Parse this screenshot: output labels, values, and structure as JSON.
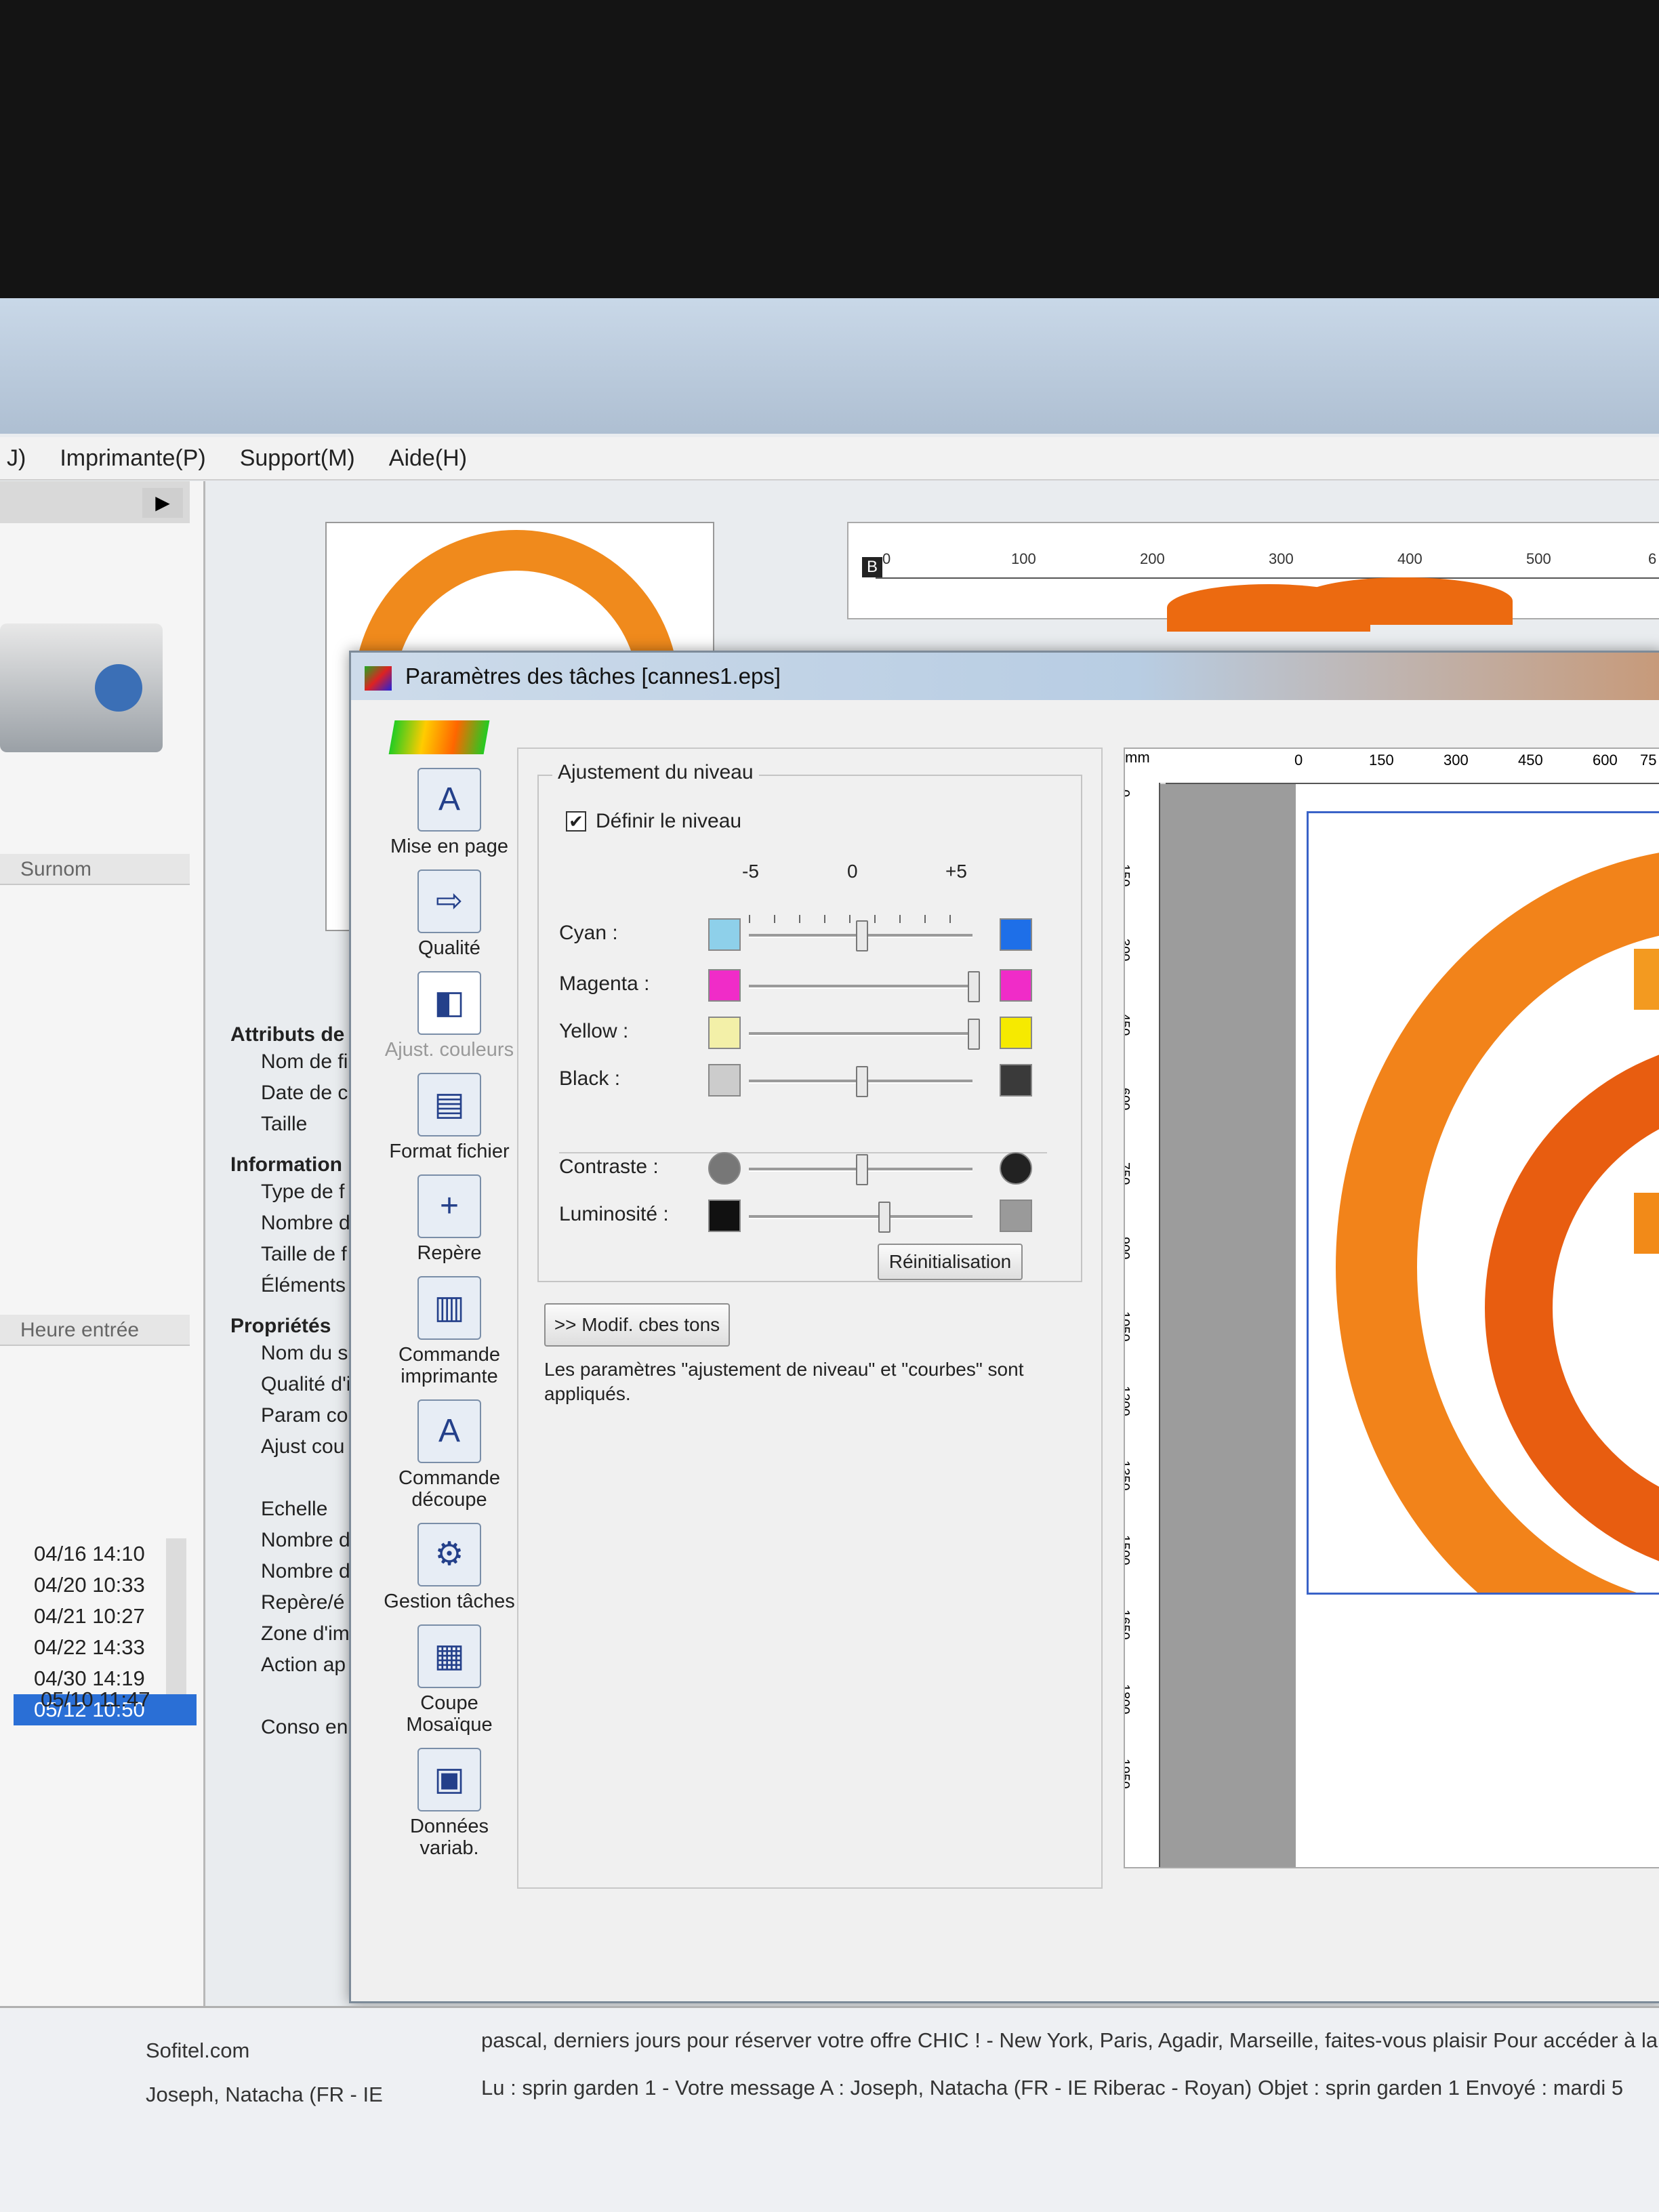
{
  "menubar": {
    "items": [
      "J)",
      "Imprimante(P)",
      "Support(M)",
      "Aide(H)"
    ]
  },
  "left_panel": {
    "col1": "Surnom",
    "col2": "Heure entrée",
    "dates": [
      "04/16 14:10",
      "04/20 10:33",
      "04/21 10:27",
      "04/22 14:33",
      "04/30 14:19",
      "05/12 10:50"
    ],
    "selected_index": 5,
    "extra_date": "05/10 11:47"
  },
  "properties": {
    "sections": [
      {
        "title": "Attributs de",
        "items": [
          "Nom de fi",
          "Date de c",
          "Taille"
        ]
      },
      {
        "title": "Information",
        "items": [
          "Type de f",
          "Nombre d",
          "Taille de f",
          "Éléments"
        ]
      },
      {
        "title": "Propriétés",
        "items": [
          "Nom du s",
          "Qualité d'i",
          "Param co",
          "Ajust cou",
          "",
          "Echelle",
          "Nombre d",
          "Nombre d",
          "Repère/é",
          "Zone d'im",
          "Action ap",
          "",
          "Conso en"
        ]
      }
    ]
  },
  "ruler_top": {
    "marker": "B",
    "ticks": [
      "0",
      "100",
      "200",
      "300",
      "400",
      "500",
      "6"
    ]
  },
  "dialog": {
    "title": "Paramètres des tâches [cannes1.eps]",
    "nav": [
      {
        "label": "Mise en page",
        "icon": "page-layout-icon",
        "glyph": "A"
      },
      {
        "label": "Qualité",
        "icon": "quality-icon",
        "glyph": "⇨"
      },
      {
        "label": "Ajust. couleurs",
        "icon": "color-adjust-icon",
        "glyph": "◧",
        "active": true
      },
      {
        "label": "Format fichier",
        "icon": "file-format-icon",
        "glyph": "▤"
      },
      {
        "label": "Repère",
        "icon": "marker-icon",
        "glyph": "+"
      },
      {
        "label": "Commande imprimante",
        "icon": "printer-command-icon",
        "glyph": "▥"
      },
      {
        "label": "Commande découpe",
        "icon": "cut-command-icon",
        "glyph": "A"
      },
      {
        "label": "Gestion tâches",
        "icon": "task-management-icon",
        "glyph": "⚙"
      },
      {
        "label": "Coupe Mosaïque",
        "icon": "tile-cut-icon",
        "glyph": "▦"
      },
      {
        "label": "Données variab.",
        "icon": "variable-data-icon",
        "glyph": "▣"
      }
    ],
    "group_title": "Ajustement du niveau",
    "checkbox_label": "Définir le niveau",
    "checkbox_checked": true,
    "scale": {
      "min": "-5",
      "mid": "0",
      "max": "+5"
    },
    "sliders": [
      {
        "label": "Cyan :",
        "value": 0,
        "left_color": "#8ed0ea",
        "right_color": "#1e6fe8"
      },
      {
        "label": "Magenta :",
        "value": 5,
        "left_color": "#f02cc8",
        "right_color": "#f02cc8"
      },
      {
        "label": "Yellow :",
        "value": 5,
        "left_color": "#f3f0a8",
        "right_color": "#f6ea00"
      },
      {
        "label": "Black :",
        "value": 0,
        "left_color": "#cccccc",
        "right_color": "#3a3a3a"
      },
      {
        "label": "Contraste :",
        "value": 0,
        "left_color": "#777777",
        "right_color": "#222222"
      },
      {
        "label": "Luminosité :",
        "value": 1,
        "left_color": "#111111",
        "right_color": "#9a9a9a"
      }
    ],
    "reset_label": "Réinitialisation",
    "tone_curve_button": ">> Modif. cbes tons",
    "note": "Les paramètres \"ajustement de niveau\" et \"courbes\" sont appliqués.",
    "preview": {
      "unit": "mm",
      "top_ticks": [
        "0",
        "150",
        "300",
        "450",
        "600",
        "75"
      ],
      "left_ticks": [
        "0",
        "150",
        "300",
        "450",
        "600",
        "750",
        "900",
        "1050",
        "1200",
        "1350",
        "1500",
        "1650",
        "1800",
        "1950"
      ]
    }
  },
  "taskbar": {
    "lines": [
      "pascal, derniers jours pour réserver votre offre CHIC ! - New York, Paris, Agadir, Marseille, faites-vous plaisir Pour accéder à la",
      "Lu : sprin garden 1 - Votre message A : Joseph, Natacha (FR - IE Riberac - Royan) Objet : sprin garden 1 Envoyé : mardi 5",
      "Sofitel.com",
      "Joseph, Natacha (FR - IE"
    ]
  }
}
